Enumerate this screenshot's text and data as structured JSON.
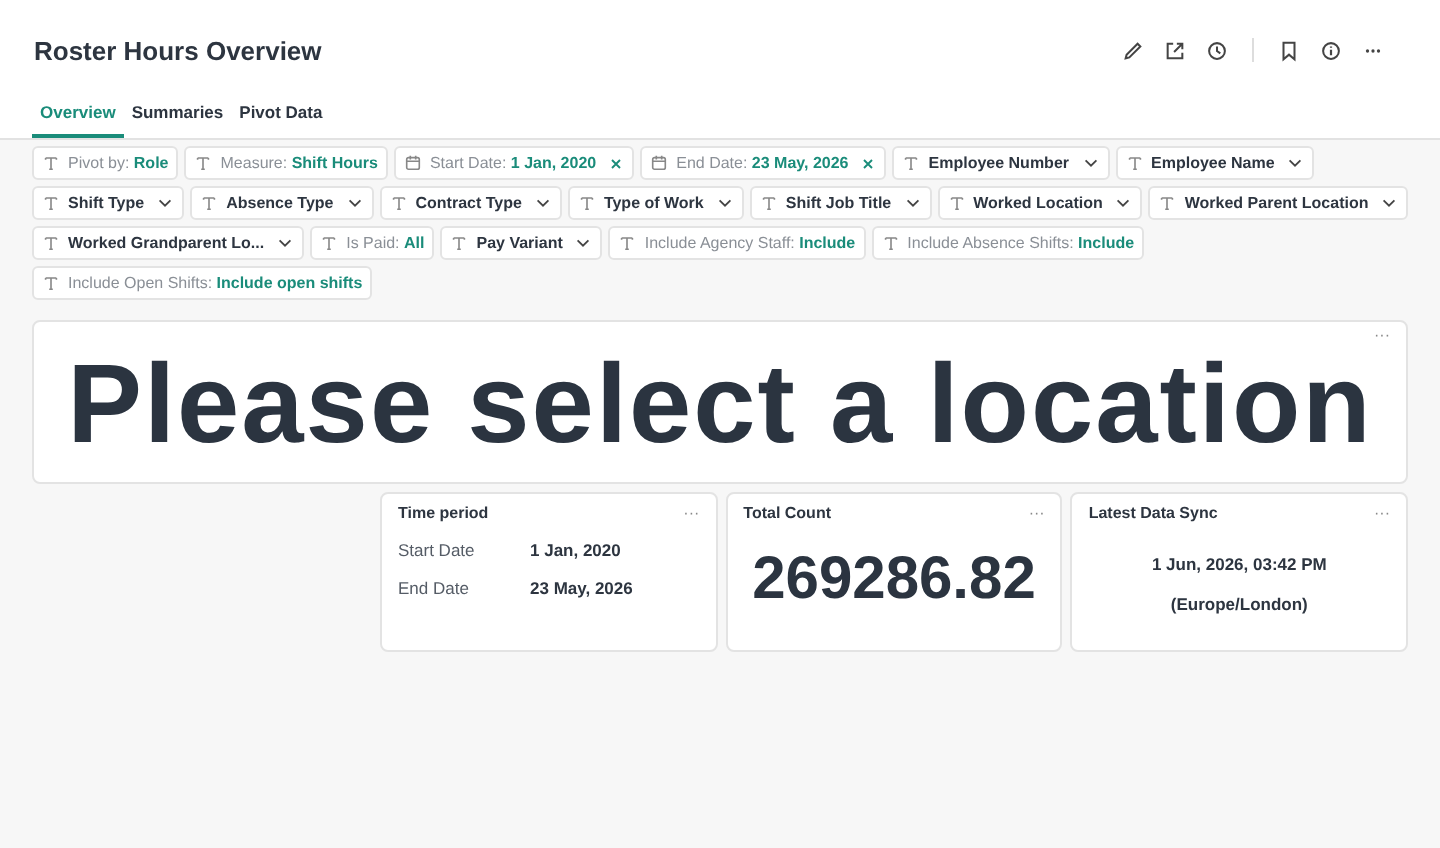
{
  "page": {
    "title": "Roster Hours Overview"
  },
  "toolbar": [
    {
      "kind": "pencil"
    },
    {
      "kind": "share"
    },
    {
      "kind": "clock"
    },
    {
      "kind": "divider"
    },
    {
      "kind": "bookmark"
    },
    {
      "kind": "info"
    },
    {
      "kind": "more"
    }
  ],
  "tabs": [
    {
      "label": "Overview",
      "selected": true
    },
    {
      "label": "Summaries",
      "selected": false
    },
    {
      "label": "Pivot Data",
      "selected": false
    }
  ],
  "filter_rows": [
    [
      {
        "kind": "labeled",
        "label": "Pivot by:",
        "value": "Role"
      },
      {
        "kind": "labeled",
        "label": "Measure:",
        "value": "Shift Hours"
      },
      {
        "kind": "date",
        "label": "Start Date:",
        "value": "1 Jan, 2020"
      },
      {
        "kind": "date",
        "label": "End Date:",
        "value": "23 May, 2026"
      },
      {
        "kind": "dropdown",
        "label": "Employee Number"
      },
      {
        "kind": "dropdown",
        "label": "Employee Name"
      }
    ],
    [
      {
        "kind": "dropdown",
        "label": "Shift Type"
      },
      {
        "kind": "dropdown",
        "label": "Absence Type"
      },
      {
        "kind": "dropdown",
        "label": "Contract Type"
      },
      {
        "kind": "dropdown",
        "label": "Type of Work"
      },
      {
        "kind": "dropdown",
        "label": "Shift Job Title"
      },
      {
        "kind": "dropdown",
        "label": "Worked Location"
      },
      {
        "kind": "dropdown",
        "label": "Worked Parent Location"
      }
    ],
    [
      {
        "kind": "dropdown",
        "label": "Worked Grandparent Lo..."
      },
      {
        "kind": "labeled",
        "label": "Is Paid:",
        "value": "All"
      },
      {
        "kind": "dropdown",
        "label": "Pay Variant"
      },
      {
        "kind": "labeled",
        "label": "Include Agency Staff:",
        "value": "Include"
      },
      {
        "kind": "labeled",
        "label": "Include Absence Shifts:",
        "value": "Include"
      }
    ],
    [
      {
        "kind": "labeled",
        "label": "Include Open Shifts:",
        "value": "Include open shifts"
      }
    ]
  ],
  "banner": {
    "text": "Please select a location",
    "menu": "···"
  },
  "cards": [
    {
      "kind": "pairs",
      "title": "Time period",
      "menu": "···",
      "rows": [
        {
          "label": "Start Date",
          "value": "1 Jan, 2020"
        },
        {
          "label": "End Date",
          "value": "23 May, 2026"
        }
      ]
    },
    {
      "kind": "big",
      "title": "Total Count",
      "menu": "···",
      "value": "269286.82"
    },
    {
      "kind": "lines",
      "title": "Latest Data Sync",
      "menu": "···",
      "lines": [
        "1 Jun, 2026, 03:42 PM",
        "(Europe/London)"
      ]
    }
  ]
}
